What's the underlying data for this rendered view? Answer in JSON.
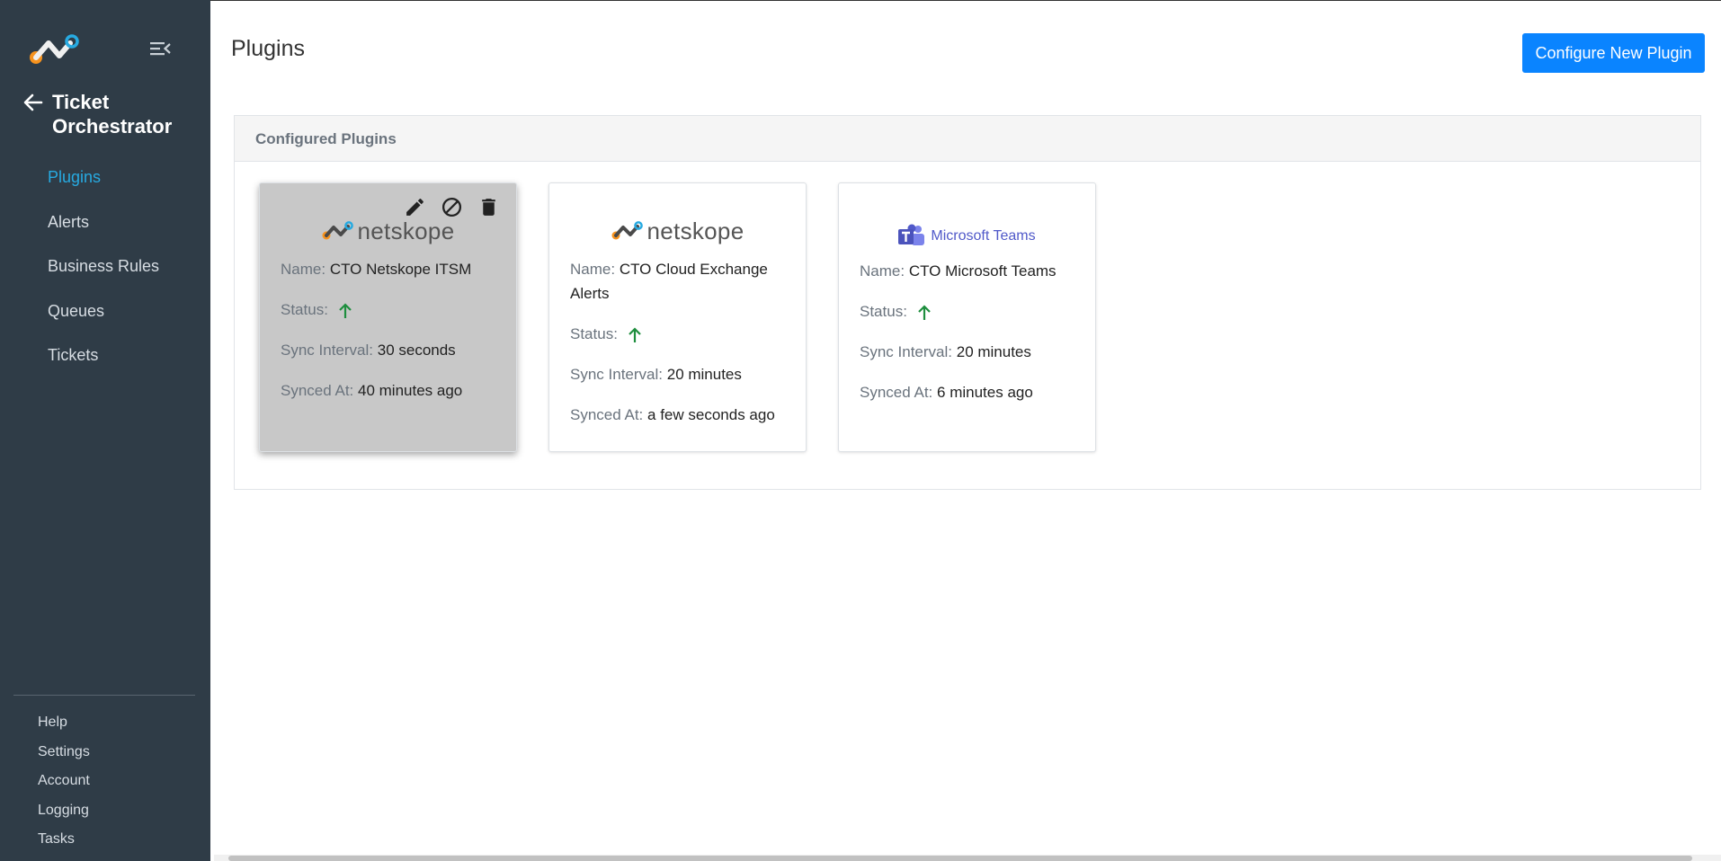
{
  "sidebar": {
    "app_title": "Ticket Orchestrator",
    "nav": [
      {
        "label": "Plugins",
        "active": true
      },
      {
        "label": "Alerts",
        "active": false
      },
      {
        "label": "Business Rules",
        "active": false
      },
      {
        "label": "Queues",
        "active": false
      },
      {
        "label": "Tickets",
        "active": false
      }
    ],
    "footer": [
      "Help",
      "Settings",
      "Account",
      "Logging",
      "Tasks"
    ]
  },
  "header": {
    "title": "Plugins",
    "configure_button": "Configure New Plugin"
  },
  "panel": {
    "title": "Configured Plugins",
    "labels": {
      "name": "Name:",
      "status": "Status:",
      "sync_interval": "Sync Interval:",
      "synced_at": "Synced At:"
    },
    "plugins": [
      {
        "logo": "netskope",
        "logo_text": "netskope",
        "name": "CTO Netskope ITSM",
        "status": "up",
        "sync_interval": "30 seconds",
        "synced_at": "40 minutes ago"
      },
      {
        "logo": "netskope",
        "logo_text": "netskope",
        "name": "CTO Cloud Exchange Alerts",
        "status": "up",
        "sync_interval": "20 minutes",
        "synced_at": "a few seconds ago"
      },
      {
        "logo": "microsoft-teams",
        "logo_text": "Microsoft Teams",
        "name": "CTO Microsoft Teams",
        "status": "up",
        "sync_interval": "20 minutes",
        "synced_at": "6 minutes ago"
      }
    ]
  },
  "colors": {
    "sidebar_bg": "#2f3c47",
    "active_nav": "#27aae1",
    "primary_button": "#0a84ff",
    "status_up": "#1e8e3e"
  },
  "icons": [
    "netskope-logo-icon",
    "collapse-menu-icon",
    "back-arrow-icon",
    "edit-icon",
    "disable-icon",
    "delete-icon",
    "status-up-icon",
    "microsoft-teams-icon"
  ]
}
